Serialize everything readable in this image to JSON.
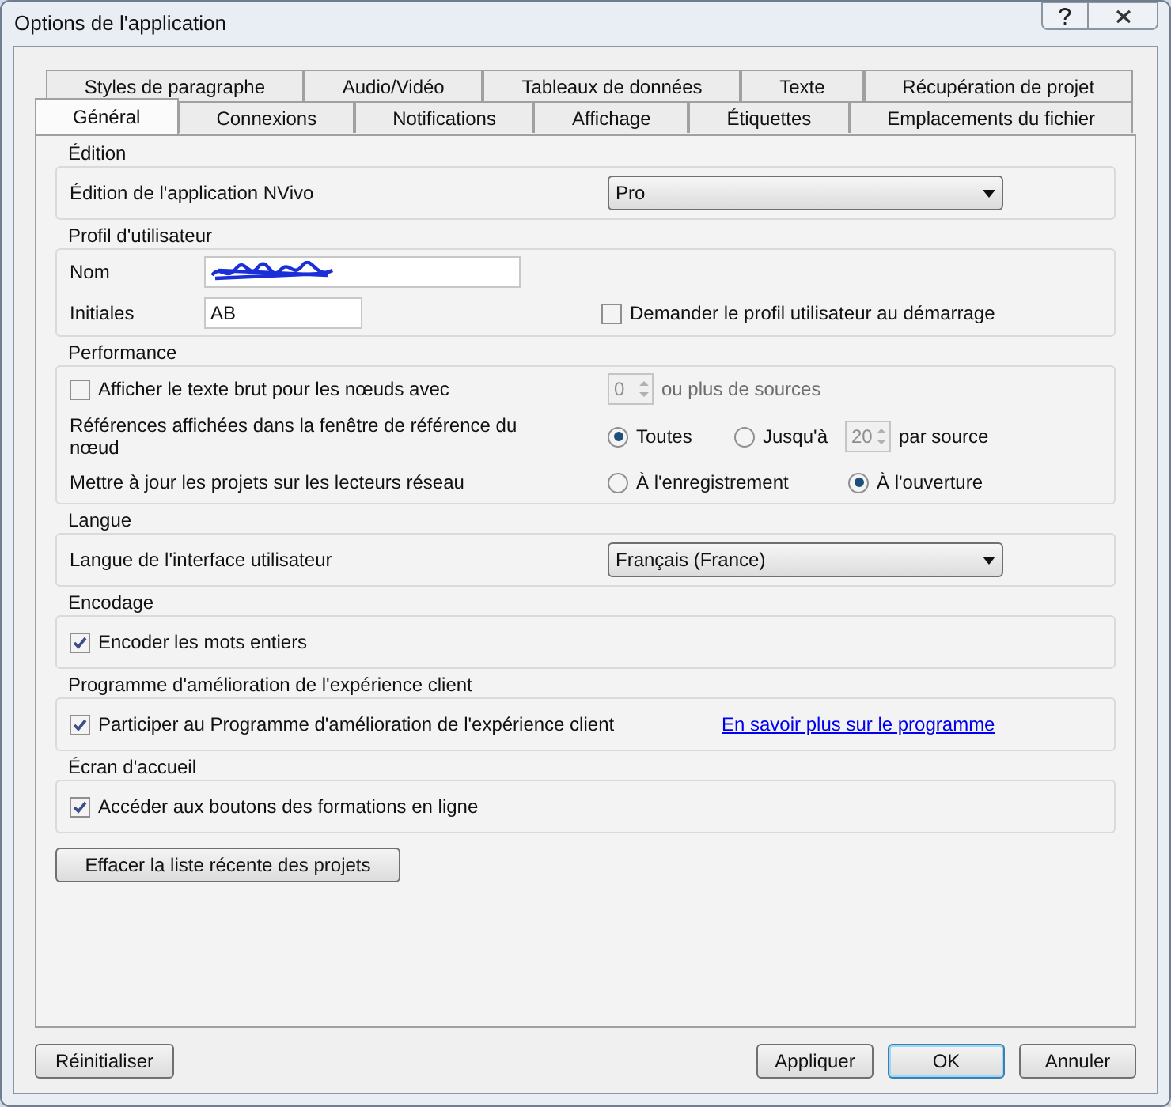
{
  "window": {
    "title": "Options de l'application"
  },
  "tab_rows": [
    {
      "tabs": [
        {
          "label": "Styles de paragraphe",
          "selected": false
        },
        {
          "label": "Audio/Vidéo",
          "selected": false
        },
        {
          "label": "Tableaux de données",
          "selected": false
        },
        {
          "label": "Texte",
          "selected": false
        },
        {
          "label": "Récupération de projet",
          "selected": false
        }
      ]
    },
    {
      "tabs": [
        {
          "label": "Général",
          "selected": true
        },
        {
          "label": "Connexions",
          "selected": false
        },
        {
          "label": "Notifications",
          "selected": false
        },
        {
          "label": "Affichage",
          "selected": false
        },
        {
          "label": "Étiquettes",
          "selected": false
        },
        {
          "label": "Emplacements du fichier",
          "selected": false
        }
      ]
    }
  ],
  "sections": [
    {
      "title": "Édition",
      "rows": [
        {
          "kind": "select",
          "label": "Édition de l'application NVivo",
          "value": "Pro"
        }
      ]
    },
    {
      "title": "Profil d'utilisateur",
      "rows": [
        {
          "kind": "text",
          "label": "Nom",
          "redacted": true
        },
        {
          "kind": "text",
          "label": "Initiales",
          "value": "AB",
          "checkbox": {
            "label": "Demander le profil utilisateur au démarrage",
            "checked": false
          }
        }
      ]
    },
    {
      "title": "Performance",
      "rows": [
        {
          "kind": "check_spinner",
          "checkbox": {
            "label": "Afficher le texte brut pour les nœuds avec",
            "checked": false
          },
          "spinner": {
            "value": "0",
            "disabled": true
          },
          "suffix": "ou plus de sources"
        },
        {
          "kind": "radios",
          "label": "Références affichées dans la fenêtre de référence du nœud",
          "options": [
            {
              "label": "Toutes",
              "selected": true
            },
            {
              "label": "Jusqu'à",
              "selected": false
            }
          ],
          "spinner": {
            "value": "20",
            "disabled": true
          },
          "suffix": "par source"
        },
        {
          "kind": "radios",
          "label": "Mettre à jour les projets sur les lecteurs réseau",
          "options": [
            {
              "label": "À l'enregistrement",
              "selected": false
            },
            {
              "label": "À l'ouverture",
              "selected": true
            }
          ]
        }
      ]
    },
    {
      "title": "Langue",
      "rows": [
        {
          "kind": "select",
          "label": "Langue de l'interface utilisateur",
          "value": "Français (France)"
        }
      ]
    },
    {
      "title": "Encodage",
      "rows": [
        {
          "kind": "checkbox",
          "checkbox": {
            "label": "Encoder les mots entiers",
            "checked": true
          }
        }
      ]
    },
    {
      "title": "Programme d'amélioration de l'expérience client",
      "rows": [
        {
          "kind": "checkbox",
          "checkbox": {
            "label": "Participer au Programme d'amélioration de l'expérience client",
            "checked": true
          },
          "link": "En savoir plus sur le programme"
        }
      ]
    },
    {
      "title": "Écran d'accueil",
      "rows": [
        {
          "kind": "checkbox",
          "checkbox": {
            "label": "Accéder aux boutons des formations en ligne",
            "checked": true
          }
        }
      ]
    }
  ],
  "clear_button": "Effacer la liste récente des projets",
  "footer": {
    "reset": "Réinitialiser",
    "buttons": [
      {
        "label": "Appliquer",
        "default": false
      },
      {
        "label": "OK",
        "default": true
      },
      {
        "label": "Annuler",
        "default": false
      }
    ]
  }
}
